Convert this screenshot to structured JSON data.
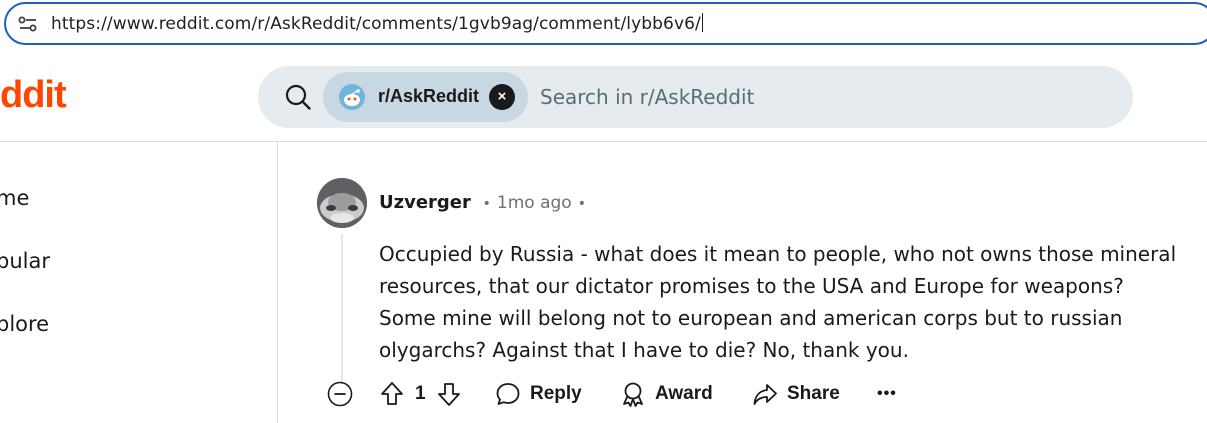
{
  "browser": {
    "url": "https://www.reddit.com/r/AskReddit/comments/1gvb9ag/comment/lybb6v6/"
  },
  "header": {
    "logo_text": "ddit",
    "search": {
      "chip_label": "r/AskReddit",
      "chip_close": "×",
      "placeholder": "Search in r/AskReddit"
    }
  },
  "sidebar": {
    "items": [
      {
        "label": "me"
      },
      {
        "label": "pular"
      },
      {
        "label": "plore"
      }
    ]
  },
  "comment": {
    "author": "Uzverger",
    "separator": "•",
    "time": "1mo ago",
    "body": "Occupied by Russia - what does it mean to people, who not owns those mineral resources, that our dictator promises to the USA and Europe for weapons? Some mine will belong not to european and american corps but to russian olygarchs? Against that I have to die? No, thank you.",
    "votes": "1",
    "actions": {
      "reply": "Reply",
      "award": "Award",
      "share": "Share",
      "more": "•••"
    }
  },
  "colors": {
    "brand": "#ff4500",
    "url_focus_border": "#1f5fbf",
    "search_bg": "#e5ebee",
    "chip_bg": "#c8d8e2"
  }
}
